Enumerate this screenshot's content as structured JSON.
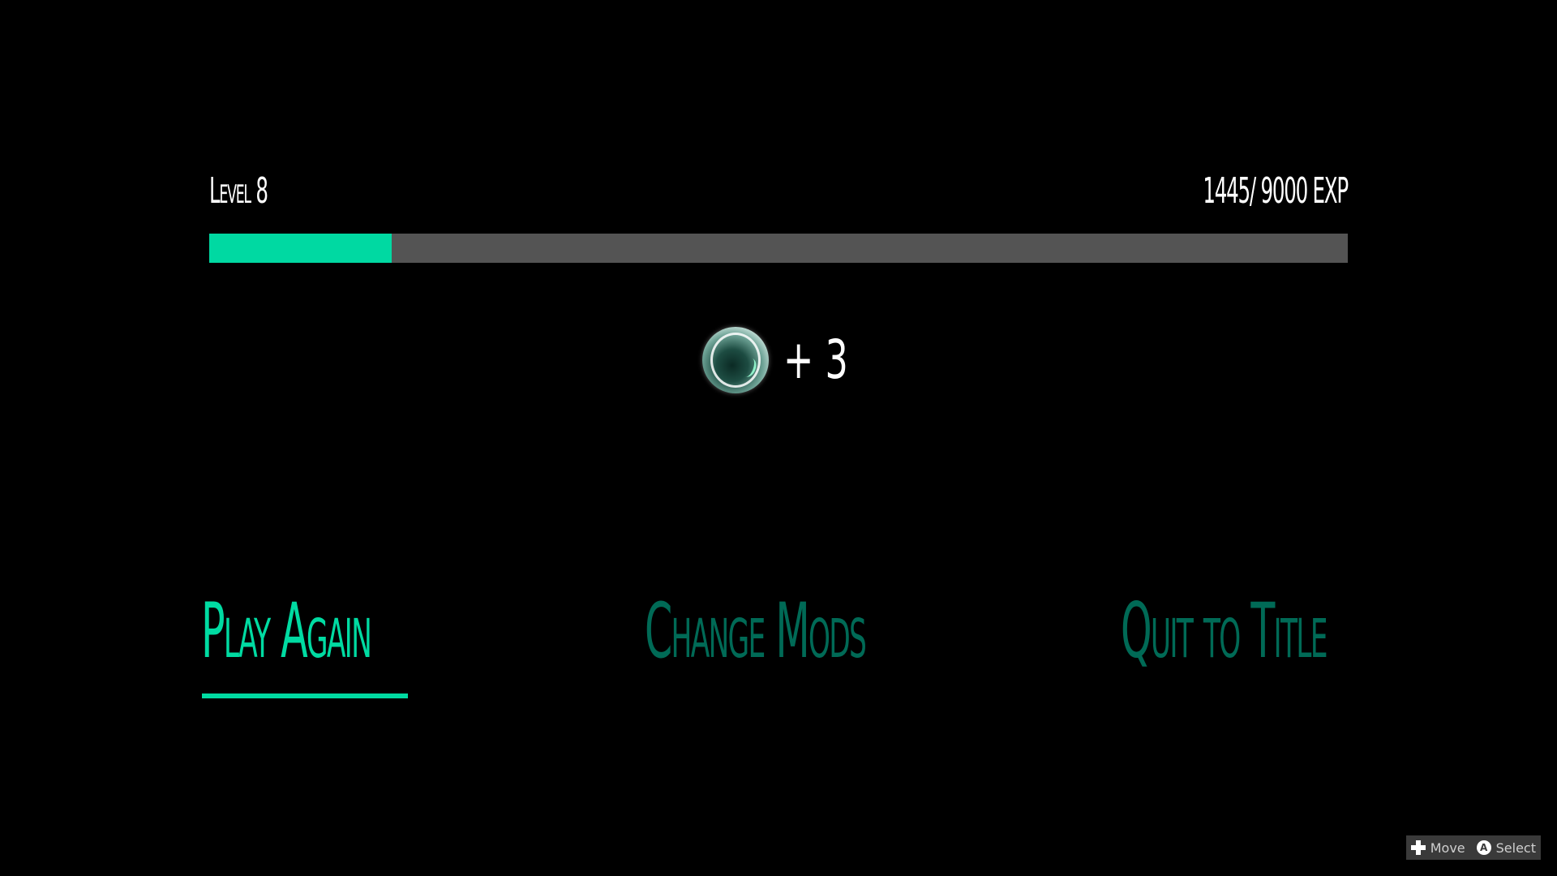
{
  "progress": {
    "level_label": "Level 8",
    "exp_label": "1445/ 9000 EXP",
    "exp_current": 1445,
    "exp_max": 9000,
    "fill_color": "#00d9a2",
    "track_color": "#545454"
  },
  "reward": {
    "icon": "orb-icon",
    "text": "+ 3"
  },
  "menu": {
    "selected_color": "#00dba2",
    "unselected_color": "#006a56",
    "options": [
      {
        "label": "Play Again",
        "selected": true
      },
      {
        "label": "Change Mods",
        "selected": false
      },
      {
        "label": "Quit to Title",
        "selected": false
      }
    ]
  },
  "hints": {
    "move_label": "Move",
    "move_icon": "dpad-icon",
    "select_label": "Select",
    "select_icon": "a-button-icon",
    "select_icon_glyph": "A"
  }
}
